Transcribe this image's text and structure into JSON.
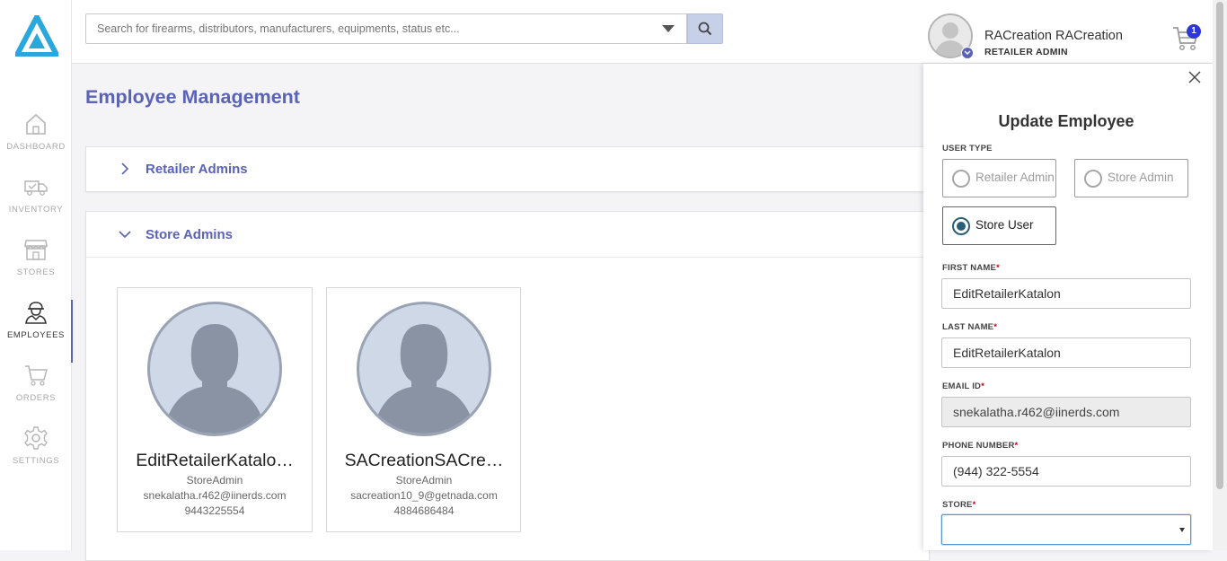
{
  "sidebar": {
    "items": [
      {
        "label": "DASHBOARD",
        "icon": "home-icon"
      },
      {
        "label": "INVENTORY",
        "icon": "truck-icon"
      },
      {
        "label": "STORES",
        "icon": "store-icon"
      },
      {
        "label": "EMPLOYEES",
        "icon": "employee-icon",
        "active": true
      },
      {
        "label": "ORDERS",
        "icon": "cart-icon"
      },
      {
        "label": "SETTINGS",
        "icon": "gear-icon"
      }
    ]
  },
  "header": {
    "search_placeholder": "Search for firearms, distributors, manufacturers, equipments, status etc...",
    "user_name": "RACreation RACreation",
    "user_role": "RETAILER ADMIN",
    "cart_count": "1"
  },
  "main": {
    "page_title": "Employee Management",
    "sections": [
      {
        "title": "Retailer Admins",
        "expanded": false
      },
      {
        "title": "Store Admins",
        "expanded": true
      }
    ],
    "employees": [
      {
        "name": "EditRetailerKatalo…",
        "role": "StoreAdmin",
        "email": "snekalatha.r462@iinerds.com",
        "phone": "9443225554"
      },
      {
        "name": "SACreationSACre…",
        "role": "StoreAdmin",
        "email": "sacreation10_9@getnada.com",
        "phone": "4884686484"
      }
    ]
  },
  "drawer": {
    "title": "Update Employee",
    "user_type_label": "USER TYPE",
    "user_types": [
      {
        "label": "Retailer Admin",
        "selected": false
      },
      {
        "label": "Store Admin",
        "selected": false
      },
      {
        "label": "Store User",
        "selected": true
      }
    ],
    "required_mark": "*",
    "first_name_label": "FIRST NAME",
    "first_name_value": "EditRetailerKatalon",
    "last_name_label": "LAST NAME",
    "last_name_value": "EditRetailerKatalon",
    "email_label": "EMAIL ID",
    "email_value": "snekalatha.r462@iinerds.com",
    "phone_label": "PHONE NUMBER",
    "phone_value": "(944) 322-5554",
    "store_label": "STORE",
    "store_value": ""
  },
  "colors": {
    "accent": "#5b63b7",
    "logo": "#2aa8de",
    "badge": "#2d36d6",
    "required": "#d0021b"
  }
}
